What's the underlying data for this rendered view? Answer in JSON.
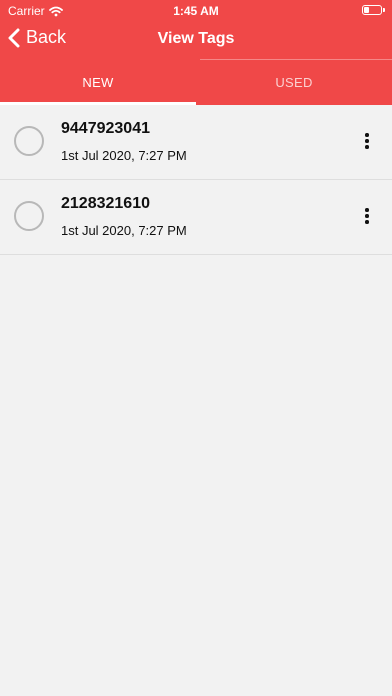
{
  "status_bar": {
    "carrier": "Carrier",
    "time": "1:45 AM"
  },
  "nav": {
    "back_label": "Back",
    "title": "View Tags"
  },
  "tabs": [
    {
      "label": "NEW",
      "active": true
    },
    {
      "label": "USED",
      "active": false
    }
  ],
  "tags": [
    {
      "number": "9447923041",
      "date": "1st Jul 2020, 7:27 PM"
    },
    {
      "number": "2128321610",
      "date": "1st Jul 2020, 7:27 PM"
    }
  ],
  "colors": {
    "accent": "#f04848",
    "background": "#f2f2f2"
  },
  "battery_level": 0.3
}
